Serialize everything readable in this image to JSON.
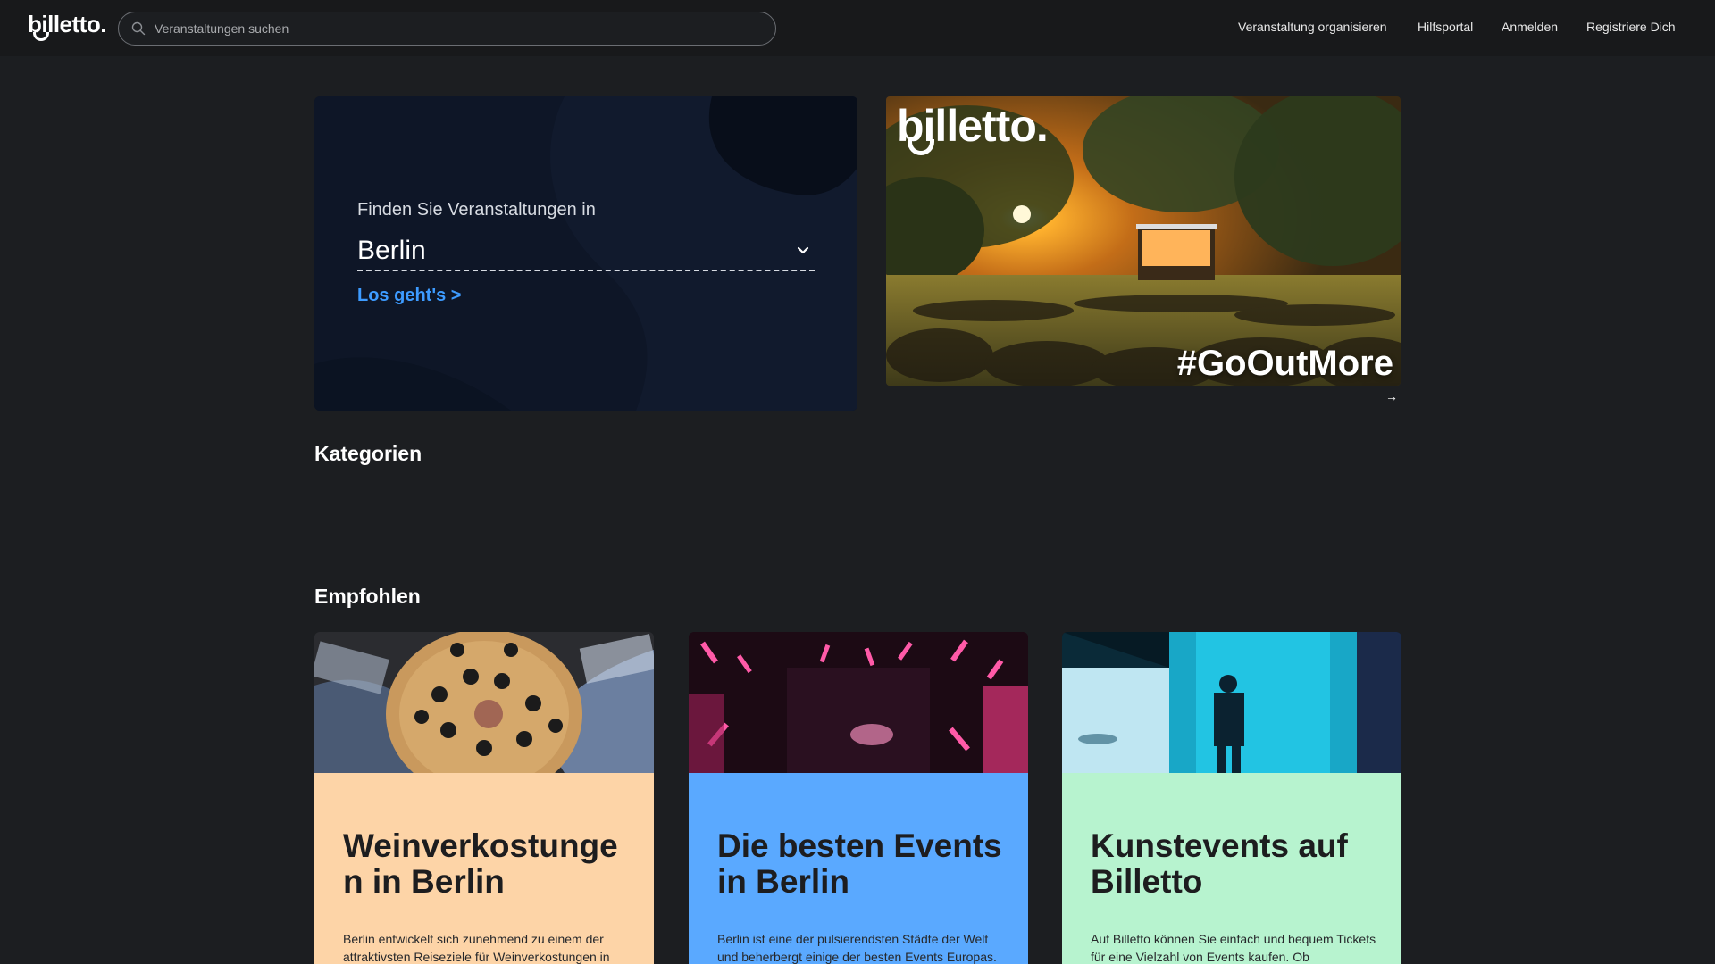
{
  "header": {
    "logo": "billetto.",
    "search_placeholder": "Veranstaltungen suchen",
    "nav": [
      "Veranstaltung organisieren",
      "Hilfsportal",
      "Anmelden",
      "Registriere Dich"
    ]
  },
  "hero": {
    "label": "Finden Sie Veranstaltungen in",
    "city": "Berlin",
    "cta": "Los geht's >"
  },
  "banner": {
    "logo": "billetto.",
    "tag": "#GoOutMore",
    "next_arrow": "→"
  },
  "sections": {
    "categories": "Kategorien",
    "recommended": "Empfohlen"
  },
  "cards": [
    {
      "title": "Weinverkostunge n in Berlin",
      "text": "Berlin entwickelt sich zunehmend zu einem der attraktivsten Reiseziele für Weinverkostungen in",
      "color": "#fdd4a7"
    },
    {
      "title": "Die besten Events in Berlin",
      "text": "Berlin ist eine der pulsierendsten Städte der Welt und beherbergt einige der besten Events Europas.",
      "color": "#5aa9ff"
    },
    {
      "title": "Kunstevents auf Billetto",
      "text": "Auf Billetto können Sie einfach und bequem Tickets für eine Vielzahl von Events kaufen. Ob",
      "color": "#b7f3cf"
    }
  ],
  "colors": {
    "background": "#1c1e21",
    "header": "#18191b",
    "accent_link": "#3d9bff"
  }
}
